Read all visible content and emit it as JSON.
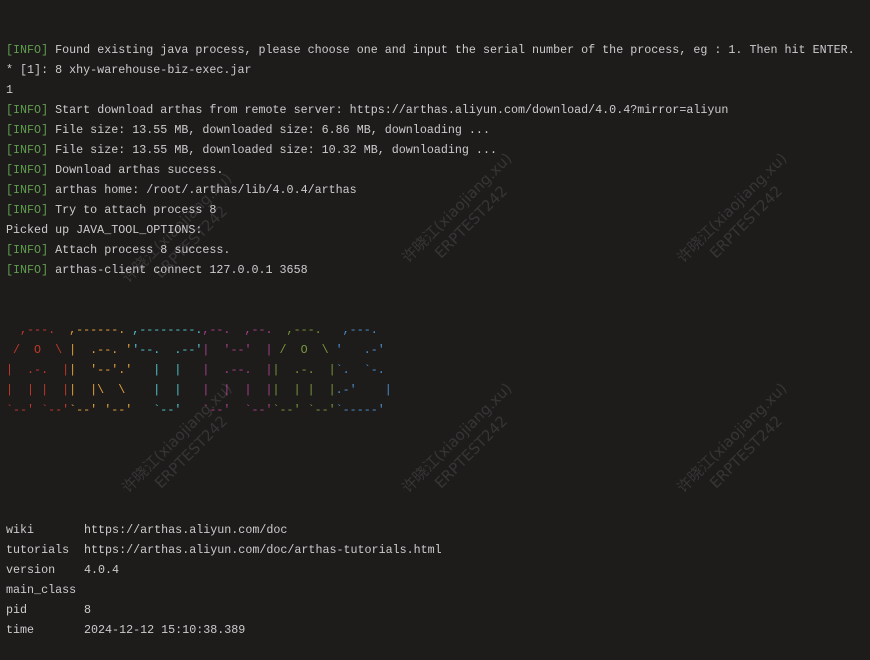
{
  "colors": {
    "background": "#1e1b1b",
    "text": "#cccccc",
    "info": "#5f9e4f"
  },
  "log": [
    {
      "tag": "[INFO]",
      "text": " Found existing java process, please choose one and input the serial number of the process, eg : 1. Then hit ENTER."
    },
    {
      "tag": "",
      "text": "* [1]: 8 xhy-warehouse-biz-exec.jar"
    },
    {
      "tag": "",
      "text": "1"
    },
    {
      "tag": "[INFO]",
      "text": " Start download arthas from remote server: https://arthas.aliyun.com/download/4.0.4?mirror=aliyun"
    },
    {
      "tag": "[INFO]",
      "text": " File size: 13.55 MB, downloaded size: 6.86 MB, downloading ..."
    },
    {
      "tag": "[INFO]",
      "text": " File size: 13.55 MB, downloaded size: 10.32 MB, downloading ..."
    },
    {
      "tag": "[INFO]",
      "text": " Download arthas success."
    },
    {
      "tag": "[INFO]",
      "text": " arthas home: /root/.arthas/lib/4.0.4/arthas"
    },
    {
      "tag": "[INFO]",
      "text": " Try to attach process 8"
    },
    {
      "tag": "",
      "text": "Picked up JAVA_TOOL_OPTIONS:"
    },
    {
      "tag": "[INFO]",
      "text": " Attach process 8 success."
    },
    {
      "tag": "[INFO]",
      "text": " arthas-client connect 127.0.0.1 3658"
    }
  ],
  "logo": {
    "colors": [
      "#c0392b",
      "#e2a33c",
      "#4fc6cc",
      "#a8418a",
      "#78993a",
      "#4a8fcc"
    ],
    "lines": [
      [
        "  ,---.  ",
        ",------. ",
        ",--------.",
        ",--.  ,--. ",
        " ,---.   ",
        ",---."
      ],
      [
        " /  O  \\ ",
        "|  .--. '",
        "'--.  .--'",
        "|  '--'  | ",
        "/  O  \\ ",
        "'   .-'"
      ],
      [
        "|  .-.  |",
        "|  '--'.'",
        "   |  |   ",
        "|  .--.  |",
        "|  .-.  |",
        "`.  `-."
      ],
      [
        "|  | |  |",
        "|  |\\  \\ ",
        "   |  |   ",
        "|  |  |  |",
        "|  | |  |",
        ".-'    |"
      ],
      [
        "`--' `--'",
        "`--' '--'",
        "   `--'   ",
        "`--'  `--'",
        "`--' `--'",
        "`-----'"
      ]
    ]
  },
  "info": [
    {
      "key": "wiki",
      "value": "https://arthas.aliyun.com/doc"
    },
    {
      "key": "tutorials",
      "value": "https://arthas.aliyun.com/doc/arthas-tutorials.html"
    },
    {
      "key": "version",
      "value": "4.0.4"
    },
    {
      "key": "main_class",
      "value": ""
    },
    {
      "key": "pid",
      "value": "8"
    },
    {
      "key": "time",
      "value": "2024-12-12 15:10:38.389"
    }
  ],
  "watermark": {
    "line1": "许晓江(xiaojiang.xu)",
    "line2": "ERPTEST242"
  }
}
